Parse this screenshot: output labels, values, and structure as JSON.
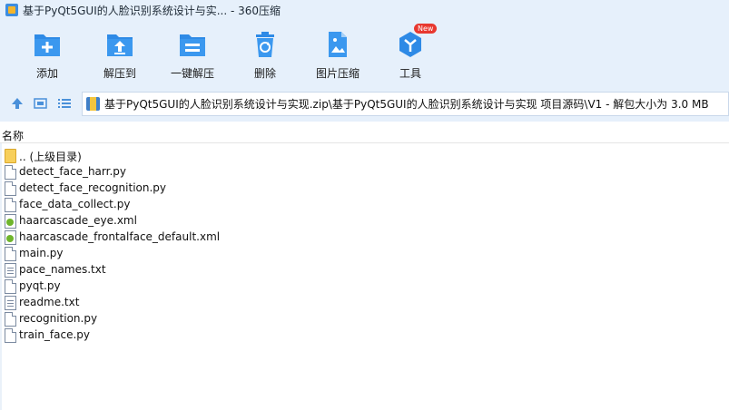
{
  "window": {
    "title": "基于PyQt5GUI的人脸识别系统设计与实... - 360压缩"
  },
  "toolbar": {
    "items": [
      {
        "label": "添加",
        "icon": "add-icon"
      },
      {
        "label": "解压到",
        "icon": "extract-to-icon"
      },
      {
        "label": "一键解压",
        "icon": "one-click-extract-icon"
      },
      {
        "label": "删除",
        "icon": "recycle-bin-icon"
      },
      {
        "label": "图片压缩",
        "icon": "image-compress-icon"
      },
      {
        "label": "工具",
        "icon": "tools-icon",
        "badge": "New"
      }
    ]
  },
  "address": {
    "path": "基于PyQt5GUI的人脸识别系统设计与实现.zip\\基于PyQt5GUI的人脸识别系统设计与实现 项目源码\\V1 - 解包大小为 3.0 MB"
  },
  "list": {
    "column_name": "名称",
    "rows": [
      {
        "name": ".. (上级目录)",
        "type": "folder"
      },
      {
        "name": "detect_face_harr.py",
        "type": "doc"
      },
      {
        "name": "detect_face_recognition.py",
        "type": "doc"
      },
      {
        "name": "face_data_collect.py",
        "type": "doc"
      },
      {
        "name": "haarcascade_eye.xml",
        "type": "xml"
      },
      {
        "name": "haarcascade_frontalface_default.xml",
        "type": "xml"
      },
      {
        "name": "main.py",
        "type": "doc"
      },
      {
        "name": "pace_names.txt",
        "type": "txt"
      },
      {
        "name": "pyqt.py",
        "type": "doc"
      },
      {
        "name": "readme.txt",
        "type": "txt"
      },
      {
        "name": "recognition.py",
        "type": "doc"
      },
      {
        "name": "train_face.py",
        "type": "doc"
      }
    ]
  },
  "colors": {
    "toolbar_bg": "#e6f0fb",
    "icon_blue": "#2e8ae6",
    "badge_red": "#e8382f"
  }
}
